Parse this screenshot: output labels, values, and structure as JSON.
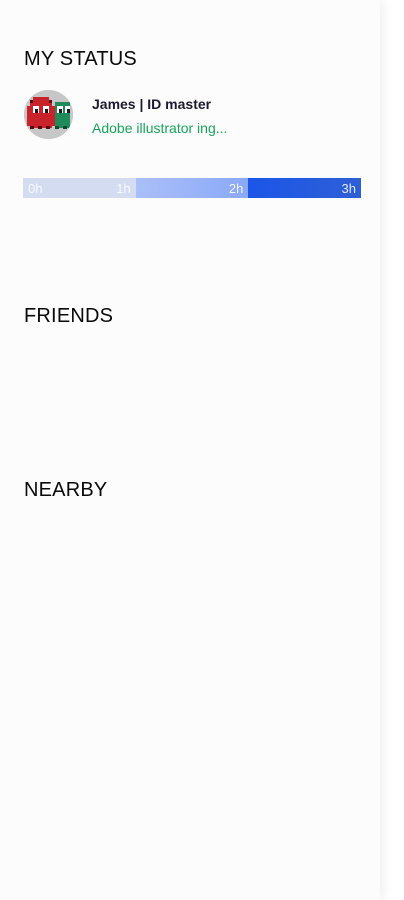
{
  "sections": {
    "my_status": "MY STATUS",
    "friends": "FRIENDS",
    "nearby": "NEARBY"
  },
  "my_status": {
    "name": "James | ID master",
    "activity": "Adobe illustrator ing...",
    "activity_color": "#19a35a",
    "avatar_icon": "pixel-ghost-avatar"
  },
  "timebar": {
    "labels": [
      "0h",
      "1h",
      "2h",
      "3h"
    ],
    "colors": [
      "#d4dcf1",
      "#9bb3f7",
      "#1f58e0"
    ]
  }
}
